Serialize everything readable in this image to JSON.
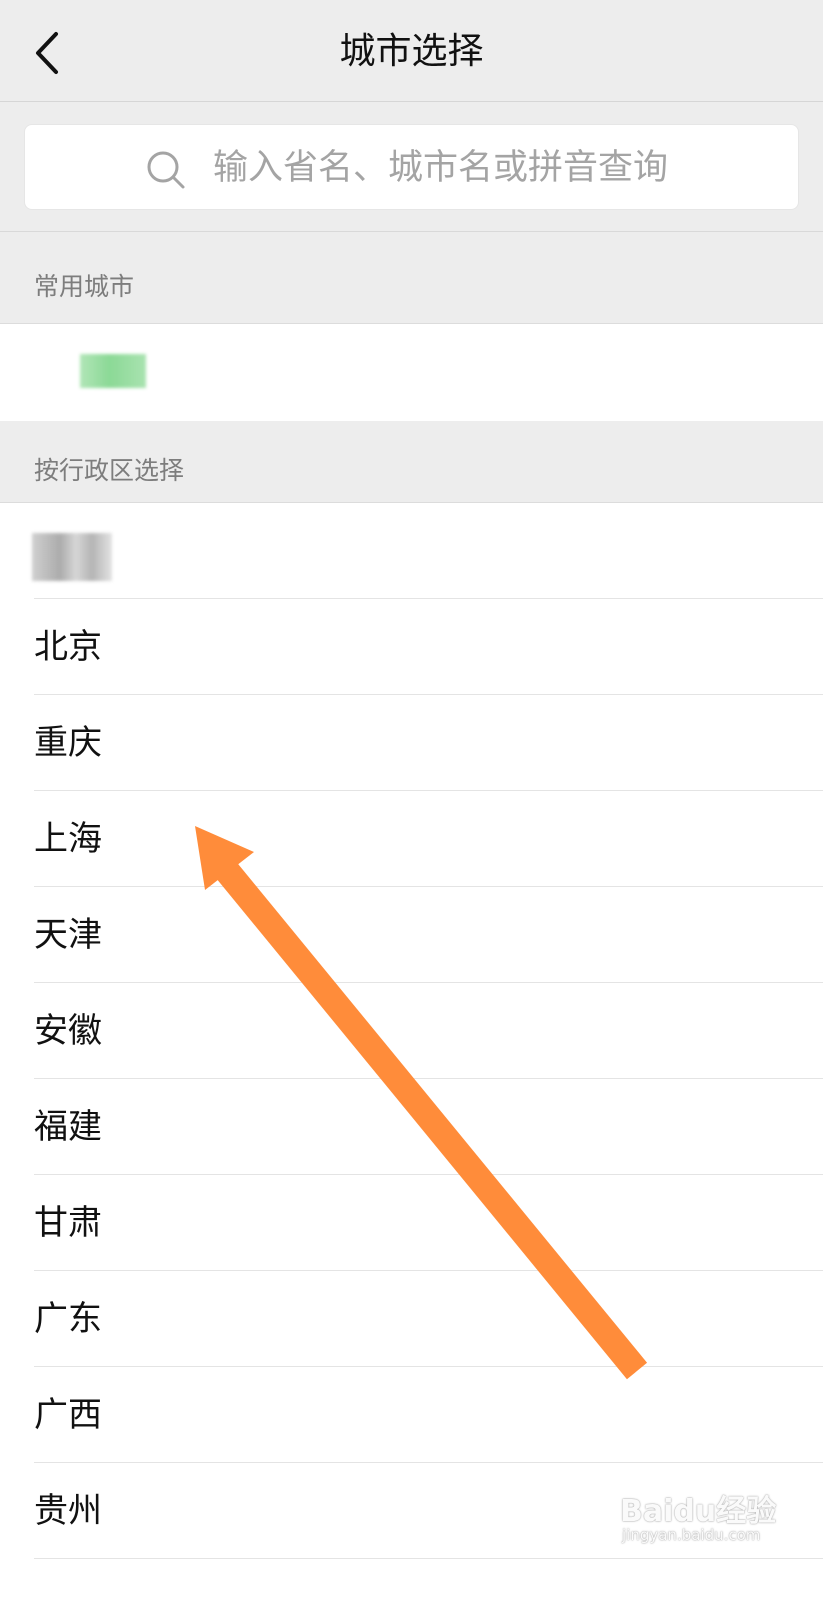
{
  "nav": {
    "title": "城市选择"
  },
  "search": {
    "placeholder": "输入省名、城市名或拼音查询"
  },
  "sections": {
    "frequent": "常用城市",
    "by_region": "按行政区选择"
  },
  "regions": [
    "北京",
    "重庆",
    "上海",
    "天津",
    "安徽",
    "福建",
    "甘肃",
    "广东",
    "广西",
    "贵州"
  ],
  "annotation": {
    "arrow_color": "#ff8c3a"
  },
  "watermark": {
    "brand": "Baidu经验",
    "url": "jingyan.baidu.com"
  }
}
